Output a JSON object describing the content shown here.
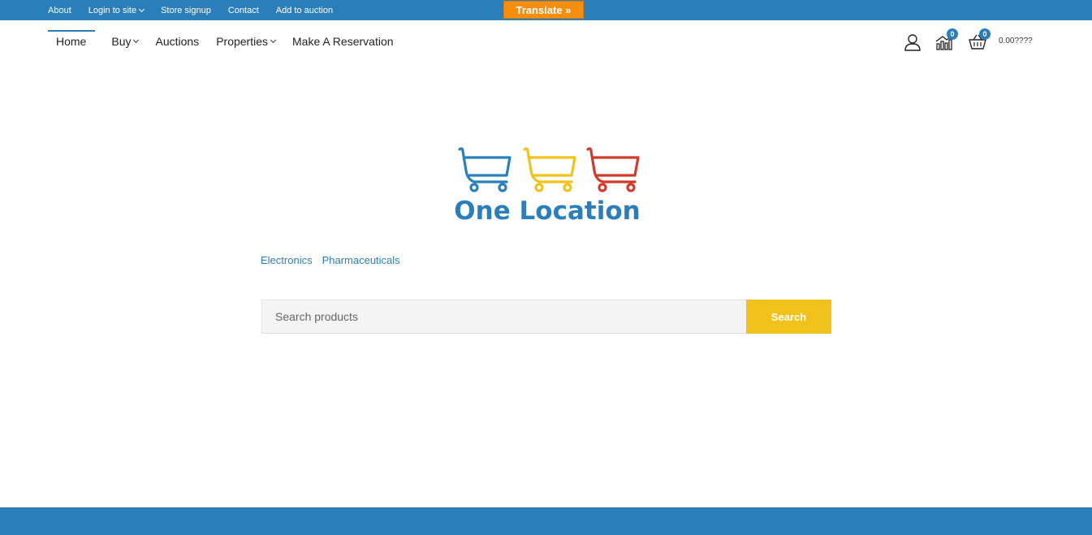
{
  "topbar": {
    "links": [
      {
        "label": "About"
      },
      {
        "label": "Login to site",
        "dropdown": true
      },
      {
        "label": "Store signup"
      },
      {
        "label": "Contact"
      },
      {
        "label": "Add to auction"
      }
    ],
    "translate_label": "Translate »"
  },
  "nav": {
    "items": [
      {
        "label": "Home"
      },
      {
        "label": "Buy"
      },
      {
        "label": "Auctions"
      },
      {
        "label": "Properties"
      },
      {
        "label": "Make A Reservation"
      }
    ]
  },
  "header": {
    "compare_count": "0",
    "cart_count": "0",
    "cart_total": "0.00????"
  },
  "logo": {
    "text": "One Location",
    "cart_colors": [
      "#2a7fbb",
      "#f1c21b",
      "#d23a2a"
    ]
  },
  "categories": [
    "Electronics",
    "Pharmaceuticals"
  ],
  "search": {
    "placeholder": "Search products",
    "button_label": "Search"
  },
  "colors": {
    "brand_blue": "#2a7fbb",
    "translate_orange": "#f58d0f",
    "search_yellow": "#f1c21b"
  }
}
